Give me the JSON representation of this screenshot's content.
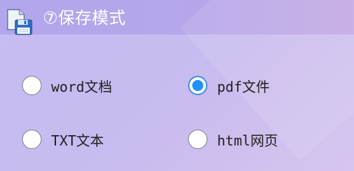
{
  "header": {
    "icon": "save-disk-icon",
    "title": "⑦保存模式"
  },
  "options": [
    {
      "label": "word文档",
      "checked": false
    },
    {
      "label": "pdf文件",
      "checked": true
    },
    {
      "label": "TXT文本",
      "checked": false
    },
    {
      "label": "html网页",
      "checked": false
    }
  ],
  "colors": {
    "header_band": "#b2a6ec",
    "panel_background": "#c6bdf2",
    "radio_selected": "#1e90ff",
    "text": "#1f1f1f",
    "title_text": "#ffffff"
  }
}
